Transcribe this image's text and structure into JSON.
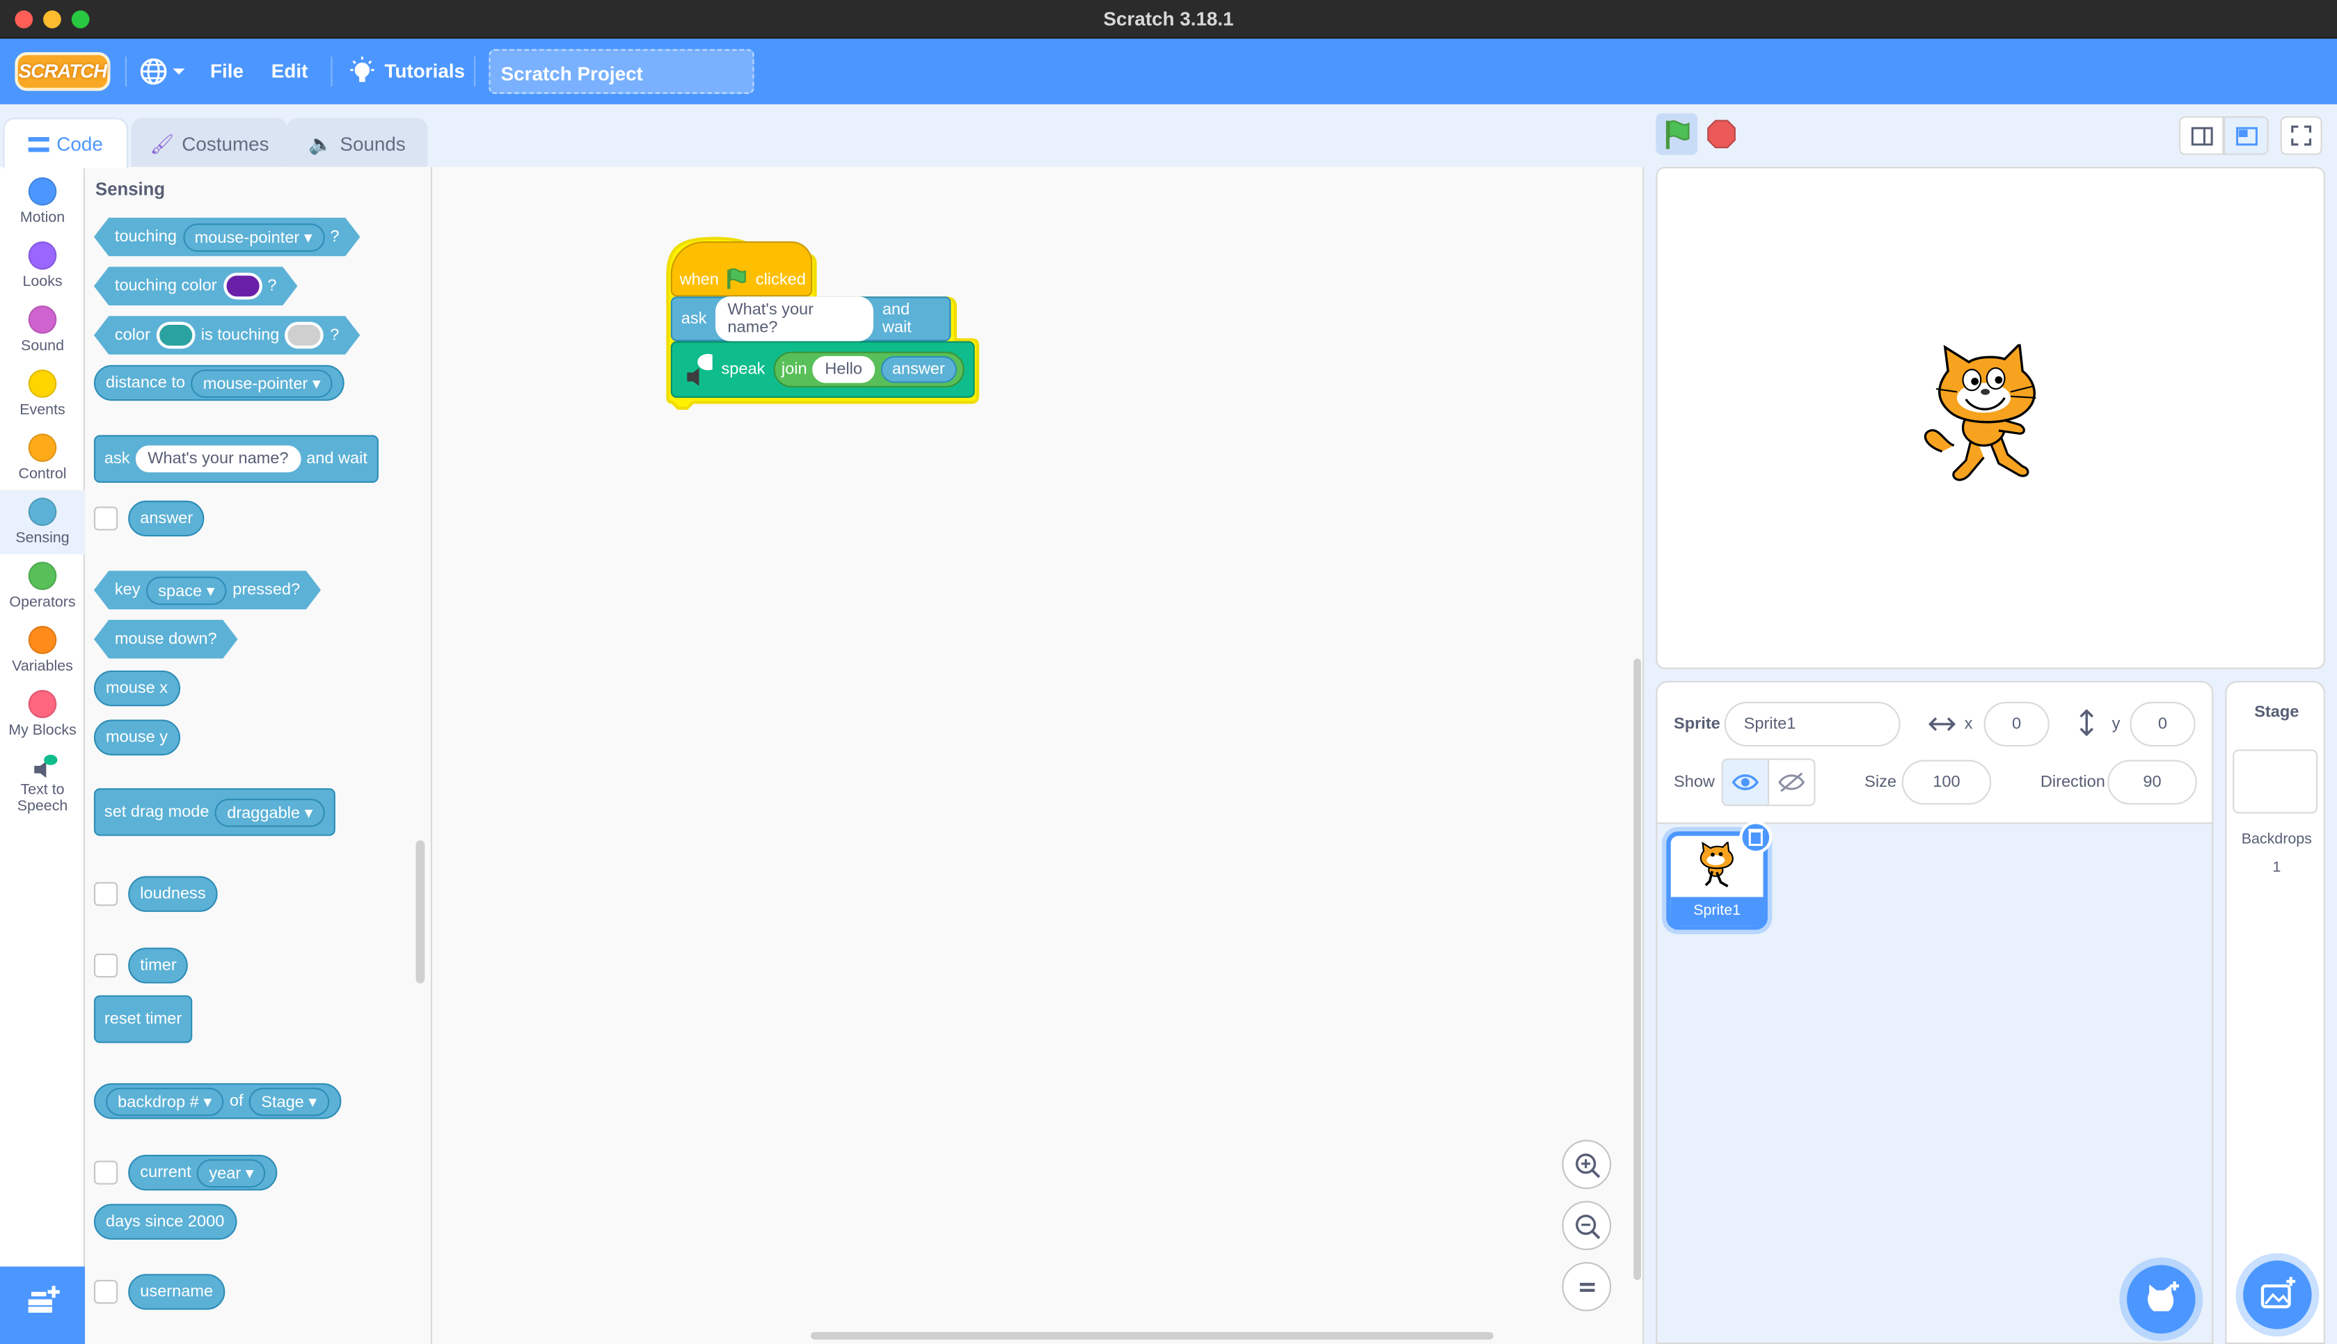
{
  "window": {
    "title": "Scratch 3.18.1"
  },
  "menubar": {
    "logo": "SCRATCH",
    "file": "File",
    "edit": "Edit",
    "tutorials": "Tutorials",
    "project_title": "Scratch Project"
  },
  "tabs": {
    "code": "Code",
    "costumes": "Costumes",
    "sounds": "Sounds"
  },
  "categories": [
    {
      "label": "Motion",
      "color": "#4c97ff"
    },
    {
      "label": "Looks",
      "color": "#9966ff"
    },
    {
      "label": "Sound",
      "color": "#cf63cf"
    },
    {
      "label": "Events",
      "color": "#ffd500"
    },
    {
      "label": "Control",
      "color": "#ffab19"
    },
    {
      "label": "Sensing",
      "color": "#5cb1d6"
    },
    {
      "label": "Operators",
      "color": "#59c059"
    },
    {
      "label": "Variables",
      "color": "#ff8c1a"
    },
    {
      "label": "My Blocks",
      "color": "#ff6680"
    },
    {
      "label": "Text to Speech",
      "color": "#0fbd8c"
    }
  ],
  "palette": {
    "title": "Sensing",
    "touching": "touching",
    "mouse_pointer": "mouse-pointer",
    "q": "?",
    "touching_color": "touching color",
    "color": "color",
    "is_touching": "is touching",
    "distance_to": "distance to",
    "ask": "ask",
    "ask_default": "What's your name?",
    "and_wait": "and wait",
    "answer": "answer",
    "key": "key",
    "space": "space",
    "pressed": "pressed?",
    "mouse_down": "mouse down?",
    "mouse_x": "mouse x",
    "mouse_y": "mouse y",
    "set_drag_mode": "set drag mode",
    "draggable": "draggable",
    "loudness": "loudness",
    "timer": "timer",
    "reset_timer": "reset timer",
    "backdrop_num": "backdrop #",
    "of": "of",
    "stage": "Stage",
    "current": "current",
    "year": "year",
    "days_since": "days since 2000",
    "username": "username"
  },
  "script": {
    "when": "when",
    "clicked": "clicked",
    "ask": "ask",
    "question": "What's your name?",
    "and_wait": "and wait",
    "speak": "speak",
    "join": "join",
    "hello": "Hello",
    "answer": "answer"
  },
  "sprite_info": {
    "sprite_label": "Sprite",
    "sprite_name": "Sprite1",
    "x_label": "x",
    "x": "0",
    "y_label": "y",
    "y": "0",
    "show_label": "Show",
    "size_label": "Size",
    "size": "100",
    "direction_label": "Direction",
    "direction": "90"
  },
  "sprite_list": [
    {
      "name": "Sprite1"
    }
  ],
  "stage_pane": {
    "title": "Stage",
    "backdrops_label": "Backdrops",
    "backdrops_count": "1"
  },
  "colors": {
    "accent": "#4c97ff",
    "sensing": "#5cb1d6",
    "events": "#ffbf00",
    "tts": "#0fbd8c",
    "operators": "#59c059",
    "highlight": "#fff200"
  }
}
